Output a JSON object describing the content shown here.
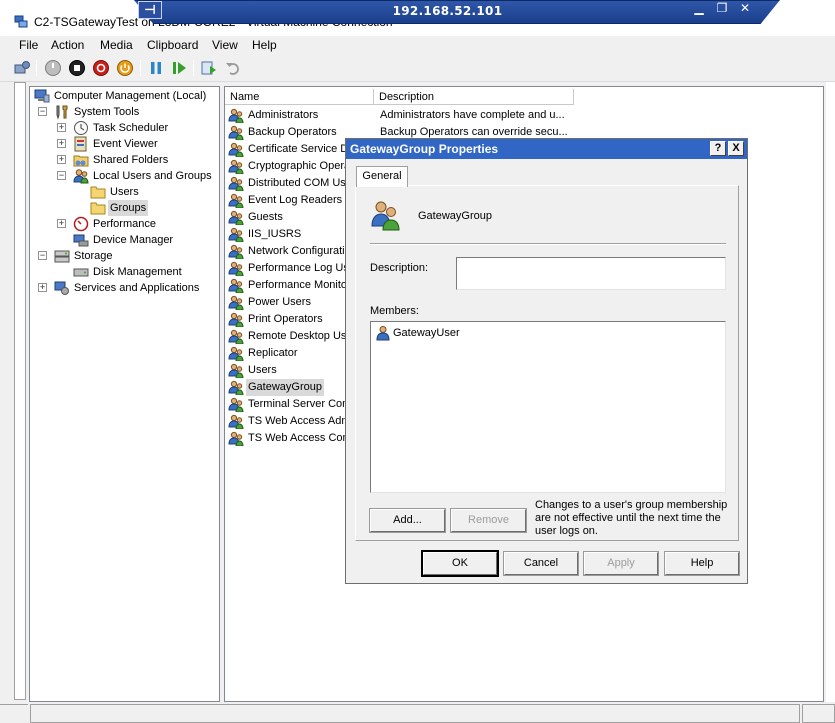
{
  "window": {
    "title": "C2-TSGatewayTest on L3DM-CORE2 - Virtual Machine Connection",
    "rdp_ip": "192.168.52.101"
  },
  "menu": [
    "File",
    "Action",
    "Media",
    "Clipboard",
    "View",
    "Help"
  ],
  "tree": {
    "root": "Computer Management (Local)",
    "system_tools": "System Tools",
    "task_scheduler": "Task Scheduler",
    "event_viewer": "Event Viewer",
    "shared_folders": "Shared Folders",
    "local_users_groups": "Local Users and Groups",
    "users": "Users",
    "groups": "Groups",
    "performance": "Performance",
    "device_manager": "Device Manager",
    "storage": "Storage",
    "disk_management": "Disk Management",
    "services_apps": "Services and Applications"
  },
  "list": {
    "columns": [
      "Name",
      "Description"
    ],
    "rows": [
      {
        "name": "Administrators",
        "desc": "Administrators have complete and u..."
      },
      {
        "name": "Backup Operators",
        "desc": "Backup Operators can override secu..."
      },
      {
        "name": "Certificate Service DCOM Access",
        "desc": ""
      },
      {
        "name": "Cryptographic Operators",
        "desc": ""
      },
      {
        "name": "Distributed COM Users",
        "desc": ""
      },
      {
        "name": "Event Log Readers",
        "desc": ""
      },
      {
        "name": "Guests",
        "desc": ""
      },
      {
        "name": "IIS_IUSRS",
        "desc": ""
      },
      {
        "name": "Network Configuration Operators",
        "desc": ""
      },
      {
        "name": "Performance Log Users",
        "desc": ""
      },
      {
        "name": "Performance Monitor Users",
        "desc": ""
      },
      {
        "name": "Power Users",
        "desc": ""
      },
      {
        "name": "Print Operators",
        "desc": ""
      },
      {
        "name": "Remote Desktop Users",
        "desc": ""
      },
      {
        "name": "Replicator",
        "desc": ""
      },
      {
        "name": "Users",
        "desc": ""
      },
      {
        "name": "GatewayGroup",
        "desc": ""
      },
      {
        "name": "Terminal Server Computers",
        "desc": ""
      },
      {
        "name": "TS Web Access Administrators",
        "desc": ""
      },
      {
        "name": "TS Web Access Computers",
        "desc": ""
      }
    ]
  },
  "dialog": {
    "title": "GatewayGroup Properties",
    "help_glyph": "?",
    "close_glyph": "X",
    "tab": "General",
    "group_name": "GatewayGroup",
    "description_label": "Description:",
    "description_value": "",
    "members_label": "Members:",
    "members": [
      "GatewayUser"
    ],
    "add_button": "Add...",
    "remove_button": "Remove",
    "note": "Changes to a user's group membership are not effective until the next time the user logs on.",
    "ok": "OK",
    "cancel": "Cancel",
    "apply": "Apply",
    "help": "Help"
  }
}
